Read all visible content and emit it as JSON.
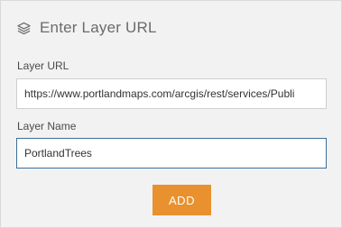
{
  "header": {
    "icon": "layers-icon",
    "title": "Enter Layer URL"
  },
  "form": {
    "url_label": "Layer URL",
    "url_value": "https://www.portlandmaps.com/arcgis/rest/services/Publi",
    "name_label": "Layer Name",
    "name_value": "PortlandTrees",
    "add_label": "ADD"
  },
  "colors": {
    "accent": "#e8912e",
    "panel_bg": "#f2f2f2",
    "focus_border": "#3c6e98"
  }
}
